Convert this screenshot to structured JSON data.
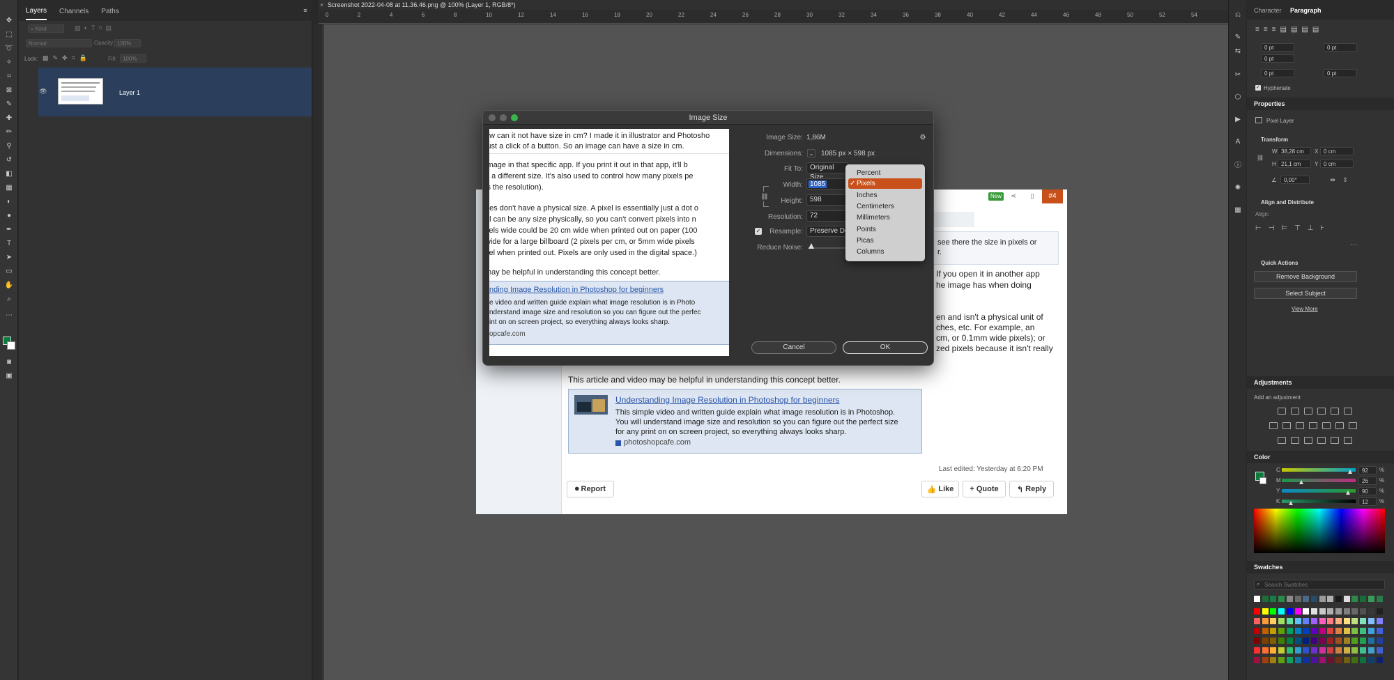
{
  "layers_panel": {
    "tabs": [
      "Layers",
      "Channels",
      "Paths"
    ],
    "filter_label": "Kind",
    "blend_mode": "Normal",
    "opacity_label": "Opacity:",
    "opacity_value": "100%",
    "lock_label": "Lock:",
    "fill_label": "Fill:",
    "fill_value": "100%",
    "layer_name": "Layer 1"
  },
  "document": {
    "tab_title": "Screenshot 2022-04-08 at 11.36.46.png @ 100% (Layer 1, RGB/8*)",
    "ruler_ticks": [
      "0",
      "2",
      "4",
      "6",
      "8",
      "10",
      "12",
      "14",
      "16",
      "18",
      "20",
      "22",
      "24",
      "26",
      "28",
      "30",
      "32",
      "34",
      "36",
      "38",
      "40",
      "42",
      "44",
      "46",
      "48",
      "50",
      "52",
      "54"
    ],
    "badge_new": "New",
    "badge_post_number": "#4",
    "right_text_1": "see there the size in pixels or",
    "right_text_2": "r.",
    "right_text_3": "If you open it in another app",
    "right_text_4": "he image has when doing",
    "right_text_5": "en and isn't a physical unit of",
    "right_text_6": "ches, etc. For example, an",
    "right_text_7": "cm, or 0.1mm wide pixels); or",
    "right_text_8": "zed pixels because it isn't really",
    "article_line": "This article and video may be helpful in understanding this concept better.",
    "link_title": "Understanding Image Resolution in Photoshop for beginners",
    "link_desc_1": "This simple video and written guide explain what image resolution is in Photoshop.",
    "link_desc_2": "You will understand image size and resolution so you can figure out the perfect size",
    "link_desc_3": "for any print on on screen project, so everything always looks sharp.",
    "link_domain": "photoshopcafe.com",
    "last_edited": "Last edited: Yesterday at 6:20 PM",
    "report_label": "Report",
    "like_label": "Like",
    "quote_label": "Quote",
    "reply_label": "Reply"
  },
  "dialog": {
    "title": "Image Size",
    "preview_lines": [
      "ow can it not have size in cm? I made it in illustrator and Photosho",
      "just a click of a button. So an image can have a size in cm.",
      "image in that specific app. If you print it out in that app, it'll b",
      "e a different size. It's also used to control how many pixels pe",
      "is the resolution).",
      "ges don't have a physical size. A pixel is essentially just a dot o",
      "el can be any size physically, so you can't convert pixels into n",
      "xels wide could be 20 cm wide when printed out on paper (100",
      "wide for a large billboard (2 pixels per cm, or 5mm wide pixels",
      "zel when printed out. Pixels are only used in the digital space.)",
      "may be helpful in understanding this concept better."
    ],
    "preview_link_title": "nding Image Resolution in Photoshop for beginners",
    "preview_link_lines": [
      "e video and written guide explain what image resolution is in Photo",
      "nderstand image size and resolution so you can figure out the perfec",
      "int on on screen project, so everything always looks sharp."
    ],
    "preview_link_domain": "opcafe.com",
    "image_size_label": "Image Size:",
    "image_size_value": "1,86M",
    "dimensions_label": "Dimensions:",
    "dimensions_value": "1085 px  ×  598 px",
    "fit_to_label": "Fit To:",
    "fit_to_value": "Original Size",
    "width_label": "Width:",
    "width_value": "1085",
    "height_label": "Height:",
    "height_value": "598",
    "resolution_label": "Resolution:",
    "resolution_value": "72",
    "resample_label": "Resample:",
    "resample_value": "Preserve De",
    "reduce_noise_label": "Reduce Noise:",
    "cancel_label": "Cancel",
    "ok_label": "OK",
    "unit_options": [
      "Percent",
      "Pixels",
      "Inches",
      "Centimeters",
      "Millimeters",
      "Points",
      "Picas",
      "Columns"
    ],
    "selected_unit": "Pixels"
  },
  "right_panel": {
    "tabs": [
      "Character",
      "Paragraph"
    ],
    "indent_values": [
      "0 pt",
      "0 pt",
      "0 pt",
      "0 pt",
      "0 pt"
    ],
    "hyphenate_label": "Hyphenate",
    "properties_title": "Properties",
    "pixel_layer_label": "Pixel Layer",
    "transform_title": "Transform",
    "w_label": "W",
    "w_value": "38,28 cm",
    "x_label": "X",
    "x_value": "0 cm",
    "h_label": "H",
    "h_value": "21,1 cm",
    "y_label": "Y",
    "y_value": "0 cm",
    "angle_value": "0,00°",
    "align_title": "Align and Distribute",
    "align_label": "Align:",
    "quick_actions_title": "Quick Actions",
    "remove_bg_label": "Remove Background",
    "select_subject_label": "Select Subject",
    "view_more_label": "View More",
    "adjustments_title": "Adjustments",
    "add_adjustment_label": "Add an adjustment",
    "color_title": "Color",
    "cmyk_labels": [
      "C",
      "M",
      "Y",
      "K"
    ],
    "cmyk_values": [
      "92",
      "26",
      "90",
      "12"
    ],
    "percent_sign": "%",
    "swatches_title": "Swatches",
    "search_swatches_placeholder": "Search Swatches"
  },
  "colors": {
    "foreground": "#0d7a3e",
    "background": "#ffffff",
    "selection_orange": "#c8511b",
    "layer_highlight": "#2b3f5c"
  }
}
